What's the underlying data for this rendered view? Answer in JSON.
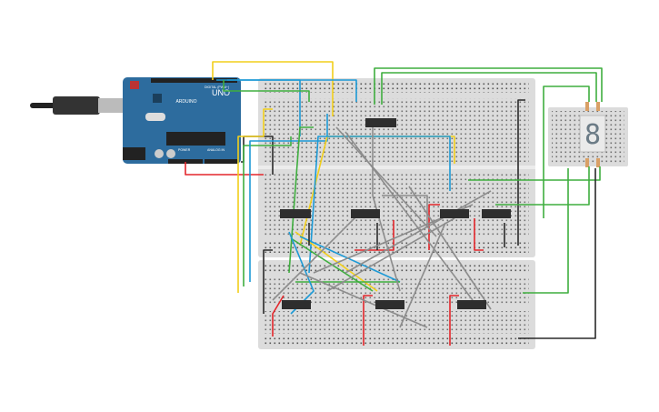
{
  "arduino": {
    "logo": "ARDUINO",
    "model": "UNO",
    "digital_label": "DIGITAL (PWM~)",
    "power_label": "POWER",
    "analog_label": "ANALOG IN",
    "board_color": "#2d6c9e"
  },
  "display": {
    "digit": "8",
    "segment_color": "#6b7b86"
  },
  "colors": {
    "red": "#e3262b",
    "black": "#2a2a2a",
    "green": "#3fae3f",
    "blue": "#1d9ad6",
    "yellow": "#f2cf1b",
    "gray": "#8c8c8c",
    "breadboard": "#dcdcdc",
    "chip": "#2e2e2e"
  }
}
